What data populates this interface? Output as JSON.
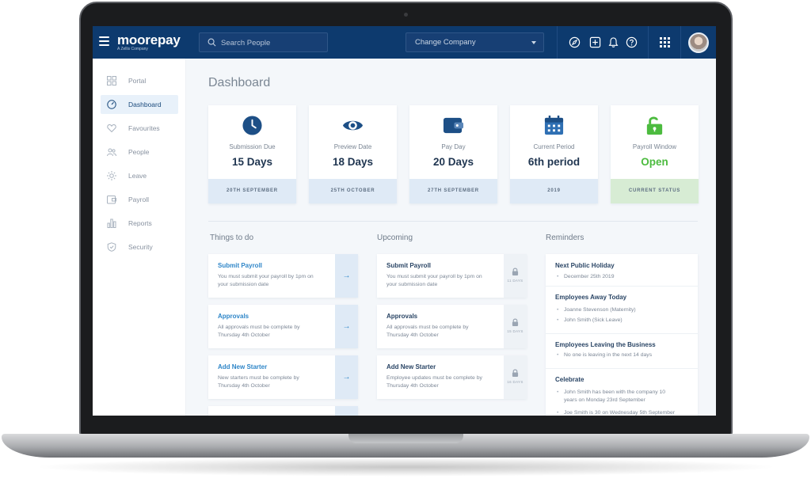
{
  "topbar": {
    "brand": "moorepay",
    "brand_sub": "A Zellis Company",
    "search_placeholder": "Search People",
    "company_select": "Change Company"
  },
  "sidebar": {
    "items": [
      {
        "label": "Portal",
        "icon": "portal-icon"
      },
      {
        "label": "Dashboard",
        "icon": "dashboard-icon",
        "active": true
      },
      {
        "label": "Favourites",
        "icon": "heart-icon"
      },
      {
        "label": "People",
        "icon": "people-icon"
      },
      {
        "label": "Leave",
        "icon": "sun-icon"
      },
      {
        "label": "Payroll",
        "icon": "wallet-icon"
      },
      {
        "label": "Reports",
        "icon": "bar-chart-icon"
      },
      {
        "label": "Security",
        "icon": "shield-icon"
      }
    ]
  },
  "main": {
    "title": "Dashboard",
    "cards": [
      {
        "label": "Submission Due",
        "value": "15 Days",
        "footer": "20TH SEPTEMBER",
        "icon": "clock-icon"
      },
      {
        "label": "Preview Date",
        "value": "18 Days",
        "footer": "25TH OCTOBER",
        "icon": "eye-icon"
      },
      {
        "label": "Pay Day",
        "value": "20 Days",
        "footer": "27TH SEPTEMBER",
        "icon": "wallet-icon"
      },
      {
        "label": "Current Period",
        "value": "6th period",
        "footer": "2019",
        "icon": "calendar-icon"
      },
      {
        "label": "Payroll Window",
        "value": "Open",
        "footer": "CURRENT STATUS",
        "icon": "unlock-icon"
      }
    ],
    "things_to_do": {
      "title": "Things to do",
      "items": [
        {
          "title": "Submit Payroll",
          "desc": "You must submit your payroll by 1pm on your submission date"
        },
        {
          "title": "Approvals",
          "desc": "All approvals must be complete by Thursday 4th October"
        },
        {
          "title": "Add New Starter",
          "desc": "New starters must be complete by Thursday 4th October"
        }
      ]
    },
    "upcoming": {
      "title": "Upcoming",
      "items": [
        {
          "title": "Submit Payroll",
          "desc": "You must submit your payroll by 1pm on your submission date",
          "days": "11 DAYS"
        },
        {
          "title": "Approvals",
          "desc": "All approvals must be complete by Thursday 4th October",
          "days": "15 DAYS"
        },
        {
          "title": "Add New Starter",
          "desc": "Employee updates must be complete by Thursday 4th October",
          "days": "16 DAYS"
        }
      ]
    },
    "reminders": {
      "title": "Reminders",
      "sections": [
        {
          "title": "Next Public Holiday",
          "items": [
            "December 25th 2019"
          ]
        },
        {
          "title": "Employees Away Today",
          "items": [
            "Joanne Stevenson (Maternity)",
            "John Smith (Sick Leave)"
          ]
        },
        {
          "title": "Employees Leaving the Business",
          "items": [
            "No one is leaving in the next 14 days"
          ]
        },
        {
          "title": "Celebrate",
          "items": [
            "John Smith has been with the company 10 years on Monday 23rd September",
            "Joe Smith is 30 on Wednesday 5th September"
          ]
        }
      ]
    }
  },
  "colors": {
    "topbar": "#0d3a6e",
    "accent": "#2f86c8",
    "open_green": "#4cbb3f"
  }
}
